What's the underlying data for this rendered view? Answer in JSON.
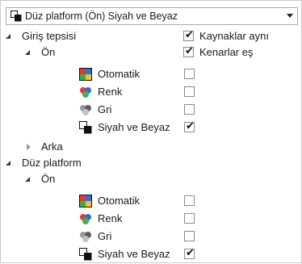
{
  "dropdown": {
    "selected": "Düz platform (Ön) Siyah ve Beyaz"
  },
  "options": {
    "sources_same": {
      "label": "Kaynaklar aynı",
      "checked": true
    },
    "edges_same": {
      "label": "Kenarlar eş",
      "checked": true
    }
  },
  "tree": {
    "input_tray": {
      "label": "Giriş tepsisi",
      "front": {
        "label": "Ön",
        "modes": [
          {
            "label": "Otomatik",
            "icon": "auto-color-icon",
            "checked": false
          },
          {
            "label": "Renk",
            "icon": "color-icon",
            "checked": false
          },
          {
            "label": "Gri",
            "icon": "gray-icon",
            "checked": false
          },
          {
            "label": "Siyah ve Beyaz",
            "icon": "black-white-icon",
            "checked": true
          }
        ]
      },
      "back": {
        "label": "Arka"
      }
    },
    "flatbed": {
      "label": "Düz platform",
      "front": {
        "label": "Ön",
        "modes": [
          {
            "label": "Otomatik",
            "icon": "auto-color-icon",
            "checked": false
          },
          {
            "label": "Renk",
            "icon": "color-icon",
            "checked": false
          },
          {
            "label": "Gri",
            "icon": "gray-icon",
            "checked": false
          },
          {
            "label": "Siyah ve Beyaz",
            "icon": "black-white-icon",
            "checked": true
          }
        ]
      }
    }
  },
  "check_glyph": "✔"
}
